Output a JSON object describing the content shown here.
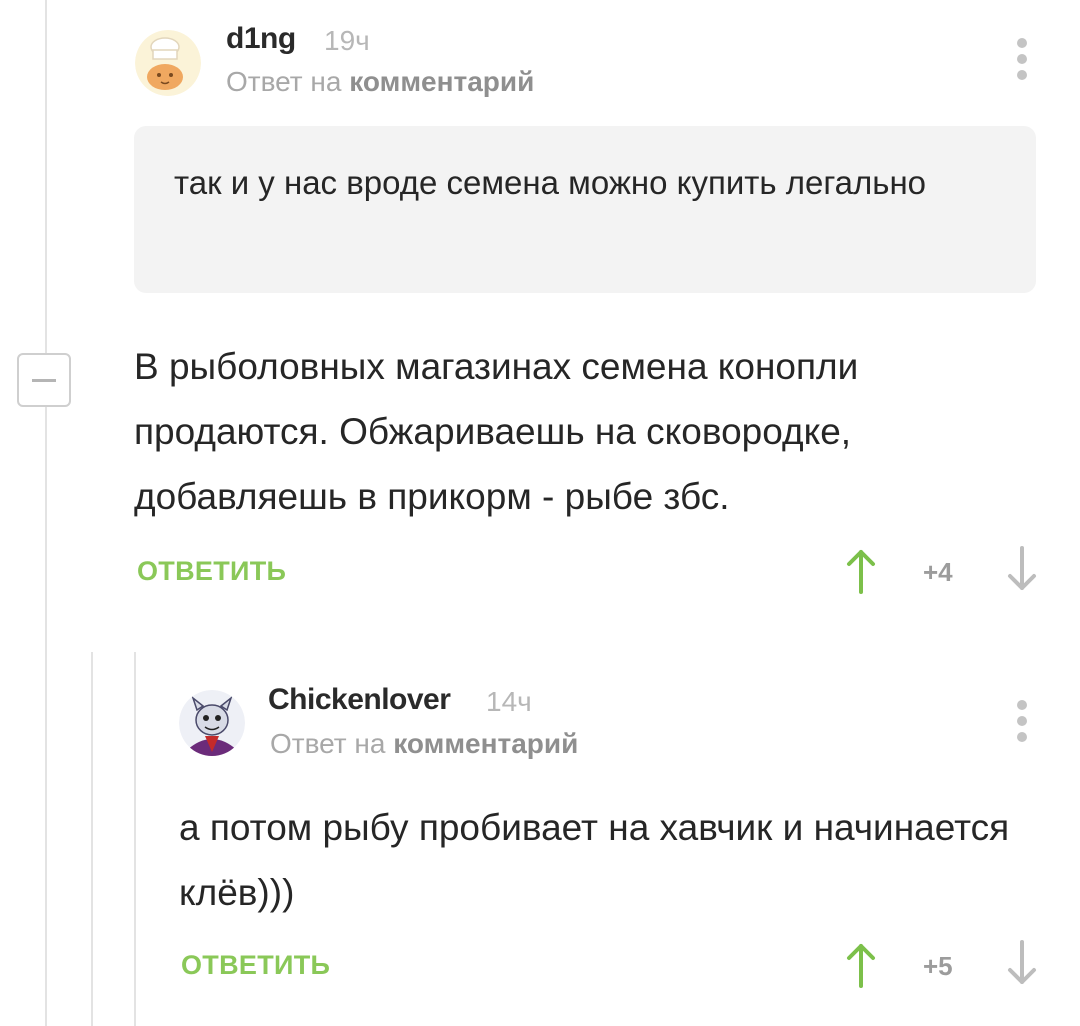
{
  "comments": [
    {
      "username": "d1ng",
      "time": "19ч",
      "reply_prefix": "Ответ на",
      "reply_target": "комментарий",
      "quote": "так и у нас вроде семена можно купить легально",
      "body": "В рыболовных магазинах семена конопли продаются. Обжариваешь на сковородке, добавляешь в прикорм - рыбе збс.",
      "reply_label": "ОТВЕТИТЬ",
      "score": "+4"
    },
    {
      "username": "Chickenlover",
      "time": "14ч",
      "reply_prefix": "Ответ на",
      "reply_target": "комментарий",
      "body": "а потом рыбу пробивает на хавчик и начинается клёв)))",
      "reply_label": "ОТВЕТИТЬ",
      "score": "+5"
    }
  ],
  "colors": {
    "accent_green": "#8ac858",
    "arrow_up": "#7cc04a",
    "arrow_down": "#bdbdbd",
    "quote_bg": "#f3f3f3"
  },
  "icons": {
    "more": "more-vertical-icon",
    "collapse": "minus-icon",
    "upvote": "arrow-up-icon",
    "downvote": "arrow-down-icon"
  }
}
